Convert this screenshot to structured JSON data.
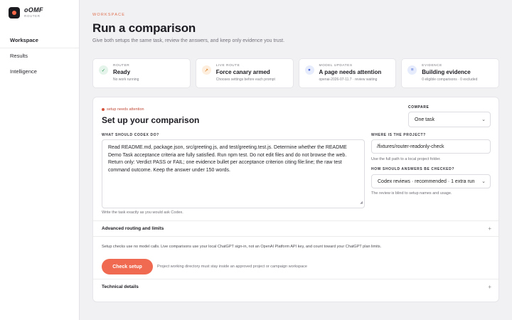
{
  "brand": {
    "name": "oOMF",
    "subtitle": "ROUTER"
  },
  "sidebar": {
    "items": [
      {
        "label": "Workspace",
        "active": true
      },
      {
        "label": "Results",
        "active": false
      },
      {
        "label": "Intelligence",
        "active": false
      }
    ]
  },
  "header": {
    "eyebrow": "WORKSPACE",
    "title": "Run a comparison",
    "subtitle": "Give both setups the same task, review the answers, and keep only evidence you trust."
  },
  "status_cards": [
    {
      "label": "ROUTER",
      "value": "Ready",
      "note": "No work running",
      "icon": "check-icon",
      "icon_glyph": "✓",
      "color": "#2f9b5b"
    },
    {
      "label": "LIVE ROUTE",
      "value": "Force canary armed",
      "note": "Chooses settings before each prompt",
      "icon": "route-arrow-icon",
      "icon_glyph": "↗",
      "color": "#e08a34"
    },
    {
      "label": "MODEL UPDATES",
      "value": "A page needs attention",
      "note": "openai-2026-07-11.7 · review waiting",
      "icon": "update-dot-icon",
      "icon_glyph": "●",
      "color": "#4a68d8"
    },
    {
      "label": "EVIDENCE",
      "value": "Building evidence",
      "note": "0 eligible comparisons · 0 excluded",
      "icon": "list-icon",
      "icon_glyph": "≡",
      "color": "#4a68d8"
    }
  ],
  "setup": {
    "attention": "setup needs attention",
    "title": "Set up your comparison",
    "compare_label": "COMPARE",
    "compare_value": "One task",
    "task_label": "WHAT SHOULD CODEX DO?",
    "task_text": "Read README.md, package.json, src/greeting.js, and test/greeting.test.js. Determine whether the README Demo Task acceptance criteria are fully satisfied. Run npm test. Do not edit files and do not browse the web. Return only: Verdict PASS or FAIL; one evidence bullet per acceptance criterion citing file:line; the raw test command outcome. Keep the answer under 150 words.",
    "task_hint": "Write the task exactly as you would ask Codex.",
    "project_label": "WHERE IS THE PROJECT?",
    "project_value": "/fixtures/router-readonly-check",
    "project_hint": "Use the full path to a local project folder.",
    "answers_label": "HOW SHOULD ANSWERS BE CHECKED?",
    "answers_value": "Codex reviews · recommended · 1 extra run",
    "answers_hint": "The review is blind to setup names and usage.",
    "advanced_label": "Advanced routing and limits",
    "notice": "Setup checks use no model calls. Live comparisons use your local ChatGPT sign-in, not an OpenAI Platform API key, and count toward your ChatGPT plan limits.",
    "check_button": "Check setup",
    "check_note": "Project working directory must stay inside an approved project or campaign workspace",
    "technical_label": "Technical details",
    "expand_glyph": "+"
  },
  "colors": {
    "accent": "#ef6a50",
    "attention": "#c24d3a"
  }
}
